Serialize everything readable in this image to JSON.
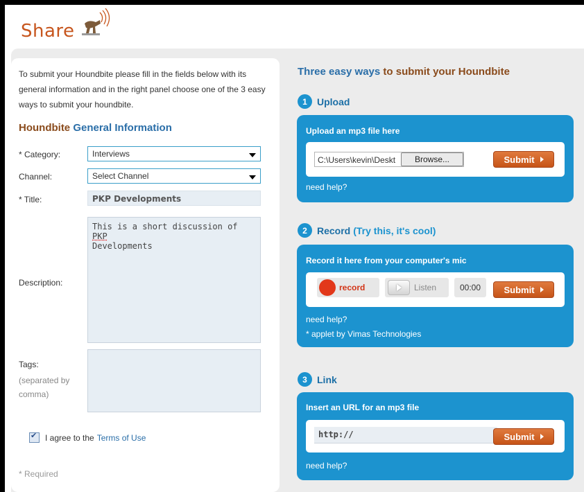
{
  "header": {
    "title": "Share"
  },
  "intro_text": "To submit your Houndbite please fill in the fields below with its general information and in the right panel choose one of the 3 easy ways to submit your houndbite.",
  "general_info": {
    "heading_part1": "Houndbite",
    "heading_part2": "General Information"
  },
  "form": {
    "category_label": "* Category:",
    "category_value": "Interviews",
    "channel_label": "Channel:",
    "channel_value": "Select Channel",
    "title_label": "* Title:",
    "title_value": "PKP Developments",
    "description_label": "Description:",
    "description_value_prefix": "This is a short discussion of ",
    "description_value_pkp": "PKP",
    "description_value_suffix": "Developments",
    "tags_label": "Tags:",
    "tags_hint": "(separated by comma)",
    "agree_text": "I agree to the",
    "terms_link": "Terms of Use",
    "agree_checked": true,
    "required_note": "* Required"
  },
  "right_panel": {
    "title_part1": "Three easy ways",
    "title_part2": "to submit your Houndbite",
    "upload": {
      "number": "1",
      "title": "Upload",
      "box_heading": "Upload an mp3 file here",
      "file_path": "C:\\Users\\kevin\\Deskt",
      "browse_label": "Browse...",
      "submit_label": "Submit",
      "help": "need help?"
    },
    "record": {
      "number": "2",
      "title": "Record",
      "title_extra": "(Try this, it's cool)",
      "box_heading": "Record it here from your computer's mic",
      "record_label": "record",
      "listen_label": "Listen",
      "timer": "00:00",
      "submit_label": "Submit",
      "help": "need help?",
      "credit": "* applet by Vimas Technologies"
    },
    "link": {
      "number": "3",
      "title": "Link",
      "box_heading": "Insert an URL for an mp3 file",
      "url_value": "http://",
      "submit_label": "Submit",
      "help": "need help?"
    }
  },
  "colors": {
    "accent_blue": "#1c93cf",
    "brand_orange": "#c7561e",
    "submit_orange": "#d8662a"
  }
}
